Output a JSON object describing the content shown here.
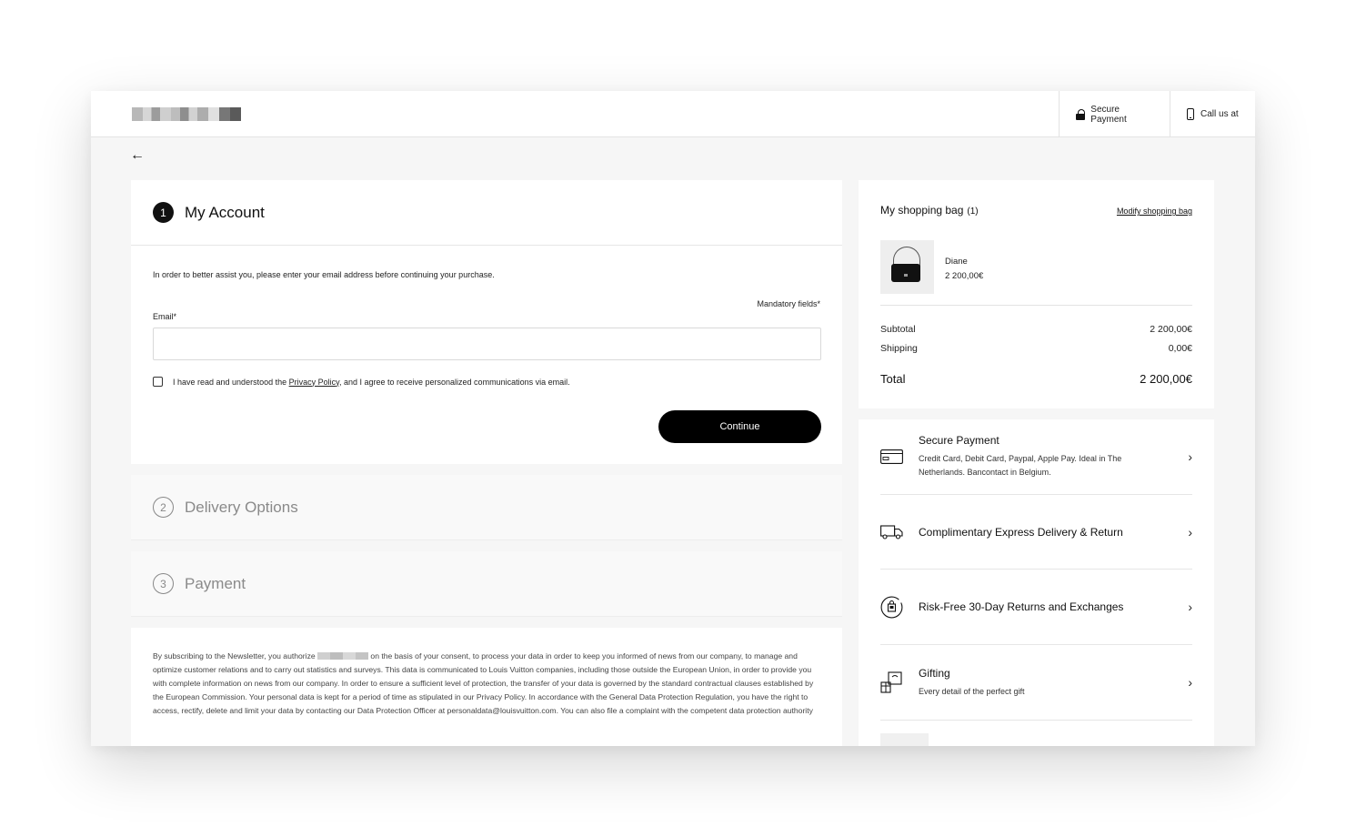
{
  "header": {
    "secure_payment": "Secure Payment",
    "call_us": "Call us at"
  },
  "nav": {
    "back_arrow": "←"
  },
  "account": {
    "step_number": "1",
    "title": "My Account",
    "intro": "In order to better assist you, please enter your email address before continuing your purchase.",
    "mandatory": "Mandatory fields*",
    "email_label": "Email*",
    "email_value": "",
    "consent_before": "I have read and understood the ",
    "consent_link": "Privacy Policy",
    "consent_after": ", and I agree to receive personalized communications via email.",
    "continue_label": "Continue"
  },
  "steps": [
    {
      "number": "2",
      "title": "Delivery Options"
    },
    {
      "number": "3",
      "title": "Payment"
    }
  ],
  "legal": {
    "text_before": "By subscribing to the Newsletter, you authorize ",
    "text_after": " on the basis of your consent, to process your data in order to keep you informed of news from our company, to manage and optimize customer relations and to carry out statistics and surveys. This data is communicated to Louis Vuitton companies, including those outside the European Union, in order to provide you with complete information on news from our company. In order to ensure a sufficient level of protection, the transfer of your data is governed by the standard contractual clauses established by the European Commission. Your personal data is kept for a period of time as stipulated in our Privacy Policy. In accordance with the General Data Protection Regulation, you have the right to access, rectify, delete and limit your data by contacting our Data Protection Officer at personaldata@louisvuitton.com. You can also file a complaint with the competent data protection authority"
  },
  "bag": {
    "title": "My shopping bag",
    "count": "(1)",
    "modify": "Modify shopping bag",
    "item_name": "Diane",
    "item_price": "2 200,00€",
    "subtotal_label": "Subtotal",
    "subtotal_value": "2 200,00€",
    "shipping_label": "Shipping",
    "shipping_value": "0,00€",
    "total_label": "Total",
    "total_value": "2 200,00€"
  },
  "services": [
    {
      "icon": "credit-card-icon",
      "title": "Secure Payment",
      "desc": "Credit Card, Debit Card, Paypal, Apple Pay. Ideal in The Netherlands. Bancontact in Belgium."
    },
    {
      "icon": "delivery-truck-icon",
      "title": "Complimentary Express Delivery & Return",
      "desc": ""
    },
    {
      "icon": "returns-bag-icon",
      "title": "Risk-Free 30-Day Returns and Exchanges",
      "desc": ""
    },
    {
      "icon": "gift-box-icon",
      "title": "Gifting",
      "desc": "Every detail of the perfect gift"
    }
  ],
  "chevron": "›"
}
